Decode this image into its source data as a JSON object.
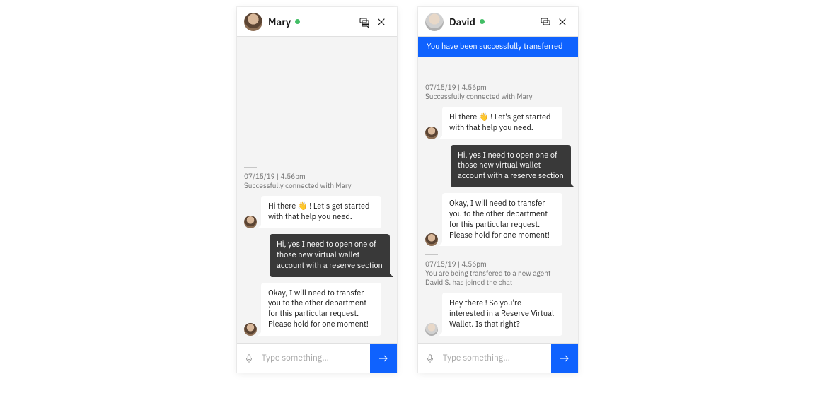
{
  "windows": [
    {
      "agent_name": "Mary",
      "banner": null,
      "meta_blocks": [
        {
          "timestamp": "07/15/19 | 4.56pm",
          "lines": [
            "Successfully connected with Mary"
          ]
        }
      ],
      "messages": [
        {
          "from": "agent",
          "text": "Hi there 👋 ! Let's get started with that help you need."
        },
        {
          "from": "user",
          "text": "Hi, yes I need to open one of those new virtual wallet account with a reserve section"
        },
        {
          "from": "agent",
          "text": "Okay, I will need to transfer you to the other department for this particular request. Please hold for one moment!"
        }
      ],
      "input_placeholder": "Type something…",
      "avatar_class": "face-a"
    },
    {
      "agent_name": "David",
      "banner": "You have been successfully transferred",
      "meta_blocks": [
        {
          "timestamp": "07/15/19 | 4.56pm",
          "lines": [
            "Successfully connected with Mary"
          ]
        },
        {
          "timestamp": "07/15/19 | 4.56pm",
          "lines": [
            "You are being transfered to a new agent",
            "David S. has joined the chat"
          ]
        }
      ],
      "messages_group1": [
        {
          "from": "agent",
          "text": "Hi there 👋 ! Let's get started with that help you need."
        },
        {
          "from": "user",
          "text": "Hi, yes I need to open one of those new virtual wallet account with a reserve section"
        },
        {
          "from": "agent",
          "text": "Okay, I will need to transfer you to the other department for this particular request. Please hold for one moment!"
        }
      ],
      "messages_group2": [
        {
          "from": "agent",
          "text": "Hey there ! So you're interested in a Reserve Virtual Wallet. Is that right?"
        }
      ],
      "input_placeholder": "Type something…",
      "avatar_class": "face-b"
    }
  ]
}
